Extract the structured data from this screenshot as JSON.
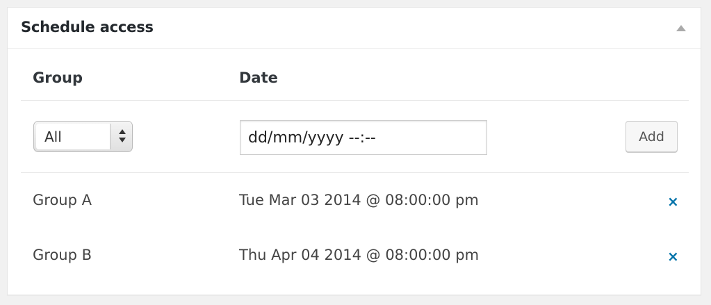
{
  "panel": {
    "title": "Schedule access"
  },
  "table": {
    "headers": {
      "group": "Group",
      "date": "Date"
    },
    "new_entry": {
      "group_select_value": "All",
      "date_placeholder": "dd/mm/yyyy --:--",
      "add_label": "Add"
    },
    "rows": [
      {
        "group": "Group A",
        "date": "Tue Mar 03 2014 @ 08:00:00 pm",
        "remove_label": "×"
      },
      {
        "group": "Group B",
        "date": "Thu Apr 04 2014 @ 08:00:00 pm",
        "remove_label": "×"
      }
    ]
  },
  "icons": {
    "toggle": "triangle-up-icon",
    "select_arrows": "up-down-arrows-icon",
    "remove": "close-icon"
  },
  "colors": {
    "accent": "#0073aa",
    "text": "#444444",
    "title": "#23282d",
    "background": "#f1f1f1",
    "panel": "#ffffff"
  }
}
